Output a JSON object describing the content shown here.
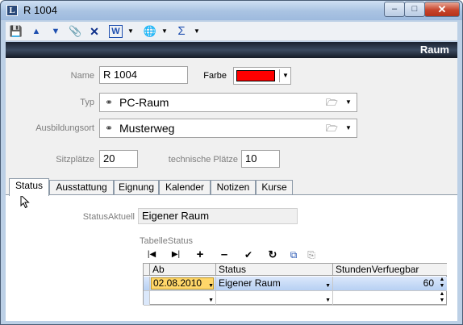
{
  "window": {
    "title": "R 1004",
    "min_label": "–",
    "max_label": "□",
    "close_label": "✕"
  },
  "toolbar": {
    "save_icon": "💾",
    "up_icon": "▲",
    "down_icon": "▼",
    "attach_icon": "📎",
    "delete_icon": "✕",
    "word_icon": "W",
    "world_icon": "🌐",
    "sum_icon": "Σ",
    "drop": "▼"
  },
  "header": {
    "title": "Raum"
  },
  "form": {
    "name_label": "Name",
    "name_value": "R 1004",
    "farbe_label": "Farbe",
    "farbe_color": "#ff0000",
    "typ_label": "Typ",
    "typ_value": "PC-Raum",
    "ausbildungsort_label": "Ausbildungsort",
    "ausbildungsort_value": "Musterweg",
    "sitzplaetze_label": "Sitzplätze",
    "sitzplaetze_value": "20",
    "tech_plaetze_label": "technische Plätze",
    "tech_plaetze_value": "10"
  },
  "tabs": [
    {
      "label": "Status"
    },
    {
      "label": "Ausstattung"
    },
    {
      "label": "Eignung"
    },
    {
      "label": "Kalender"
    },
    {
      "label": "Notizen"
    },
    {
      "label": "Kurse"
    }
  ],
  "status_panel": {
    "status_aktuell_label": "StatusAktuell",
    "status_aktuell_value": "Eigener Raum",
    "table_label": "TabelleStatus",
    "table_toolbar": [
      "|◀",
      "▶|",
      "+",
      "–",
      "✔",
      "↻",
      "⧉",
      "⎘"
    ],
    "columns": [
      "Ab",
      "Status",
      "StundenVerfuegbar"
    ],
    "rows": [
      {
        "ab": "02.08.2010",
        "status": "Eigener Raum",
        "stunden": "60"
      }
    ]
  }
}
